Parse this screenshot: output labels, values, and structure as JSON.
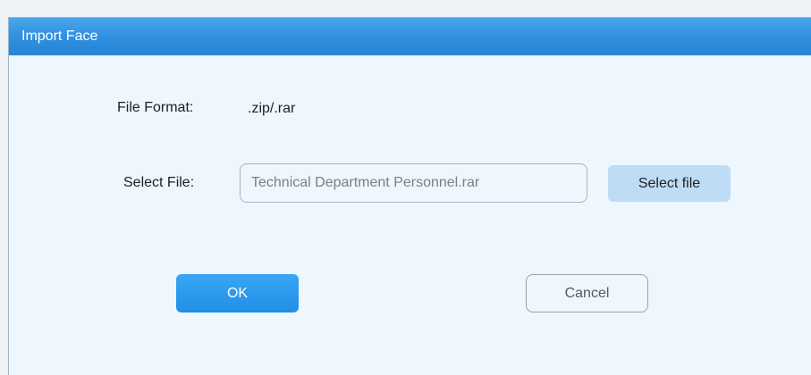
{
  "dialog": {
    "title": "Import Face",
    "file_format_label": "File Format:",
    "file_format_value": ".zip/.rar",
    "select_file_label": "Select File:",
    "selected_file_value": "Technical Department Personnel.rar",
    "select_file_button": "Select file",
    "ok_button": "OK",
    "cancel_button": "Cancel"
  },
  "colors": {
    "titlebar": "#2f8edf",
    "dialog_background": "#eef6fe",
    "ok_button": "#1f8fe6",
    "select_file_button": "#bfdcf6"
  }
}
